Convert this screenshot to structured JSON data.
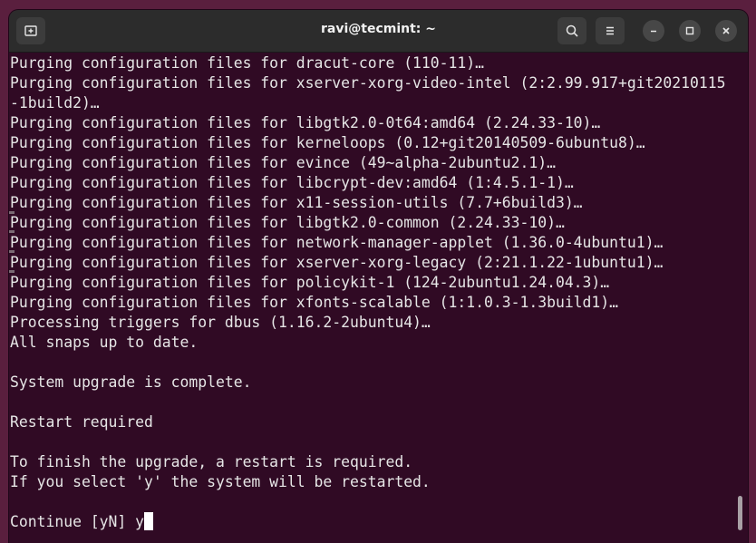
{
  "window": {
    "title": "ravi@tecmint: ~"
  },
  "header": {
    "new_tab_icon": "new-tab-icon",
    "search_icon": "search-icon",
    "menu_icon": "hamburger-menu-icon",
    "minimize_icon": "minimize-icon",
    "maximize_icon": "maximize-icon",
    "close_icon": "close-icon"
  },
  "terminal": {
    "lines": [
      "Purging configuration files for dracut-core (110-11)…",
      "Purging configuration files for xserver-xorg-video-intel (2:2.99.917+git20210115",
      "-1build2)…",
      "Purging configuration files for libgtk2.0-0t64:amd64 (2.24.33-10)…",
      "Purging configuration files for kerneloops (0.12+git20140509-6ubuntu8)…",
      "Purging configuration files for evince (49~alpha-2ubuntu2.1)…",
      "Purging configuration files for libcrypt-dev:amd64 (1:4.5.1-1)…",
      "Purging configuration files for x11-session-utils (7.7+6build3)…",
      "Purging configuration files for libgtk2.0-common (2.24.33-10)…",
      "Purging configuration files for network-manager-applet (1.36.0-4ubuntu1)…",
      "Purging configuration files for xserver-xorg-legacy (2:21.1.22-1ubuntu1)…",
      "Purging configuration files for policykit-1 (124-2ubuntu1.24.04.3)…",
      "Purging configuration files for xfonts-scalable (1:1.0.3-1.3build1)…",
      "Processing triggers for dbus (1.16.2-2ubuntu4)…",
      "All snaps up to date.",
      "",
      "System upgrade is complete.",
      "",
      "Restart required",
      "",
      "To finish the upgrade, a restart is required.",
      "If you select 'y' the system will be restarted.",
      "",
      "Continue [yN] y"
    ]
  },
  "colors": {
    "terminal_bg": "#300a24",
    "text": "#e6e6e6",
    "titlebar_bg": "#2c2c2c"
  }
}
